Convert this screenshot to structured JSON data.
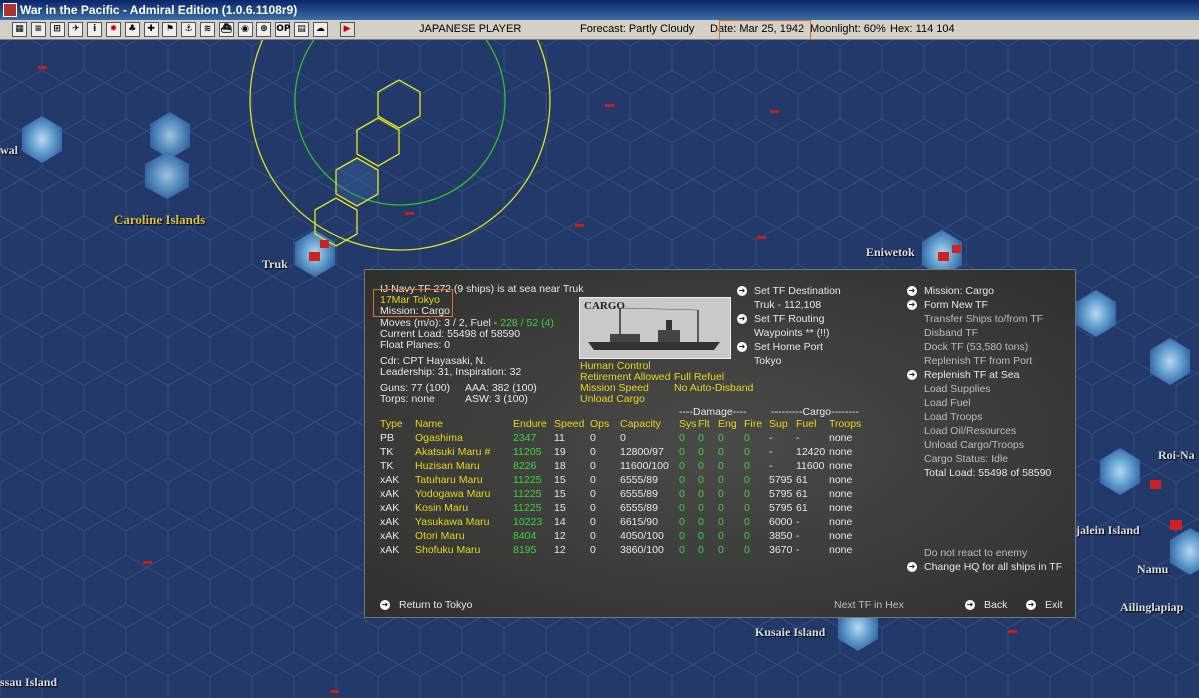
{
  "window": {
    "title": "War in the Pacific - Admiral Edition (1.0.6.1108r9)"
  },
  "toolbar": {
    "player": "JAPANESE PLAYER",
    "forecast": "Forecast: Partly Cloudy",
    "date": "Date: Mar 25, 1942",
    "moonlight": "Moonlight: 60%",
    "hex": "Hex: 114 104",
    "buttons": [
      "map-icon",
      "list-icon",
      "ship-icon",
      "air-icon",
      "info-icon",
      "flag-icon",
      "ground-icon",
      "plane-icon",
      "base-icon",
      "convoy-icon",
      "hq-icon",
      "fleet-icon",
      "globe-icon",
      "report-icon",
      "op-icon",
      "list2-icon",
      "cloud-icon",
      "end-turn-icon"
    ]
  },
  "map_labels": {
    "caroline": "Caroline Islands",
    "truk": "Truk",
    "eniwetok": "Eniwetok",
    "roi": "Roi-Na",
    "jalein": "jalein Island",
    "namu": "Namu",
    "ailing": "Ailinglapiap",
    "kusaie": "Kusaie Island",
    "ssau": "ssau Island",
    "wal": "wal"
  },
  "panel": {
    "header": "IJ Navy TF 272 (9 ships) is at sea near Truk",
    "origin": "17Mar Tokyo",
    "mission": "Mission: Cargo",
    "moves_label": "Moves (m/o): 3 / 2, Fuel - ",
    "moves_fuel": "228 / 52 (4)",
    "current_load": "Current Load: 55498 of 58590",
    "float_planes": "Float Planes: 0",
    "cdr": "Cdr: CPT  Hayasaki, N.",
    "leadership": "Leadership: 31, Inspiration: 32",
    "guns": "Guns: 77 (100)",
    "aaa": "AAA: 382 (100)",
    "torps": "Torps: none",
    "asw": "ASW: 3 (100)",
    "ship_label": "CARGO",
    "options_left": [
      "Human Control",
      "Retirement Allowed",
      "Mission Speed",
      "Unload Cargo"
    ],
    "options_right": [
      "Full Refuel",
      "No Auto-Disband"
    ],
    "center_actions": {
      "set_destination": "Set TF Destination",
      "destination": "Truk - 112,108",
      "set_routing": "Set TF Routing",
      "waypoints": "Waypoints ** (!!)",
      "set_home": "Set Home Port",
      "home": "Tokyo"
    },
    "right_actions": {
      "mission": "Mission: Cargo",
      "form_new": "Form New TF",
      "transfer": "Transfer Ships to/from TF",
      "disband": "Disband TF",
      "dock": "Dock TF (53,580 tons)",
      "replenish_port": "Replenish TF from Port",
      "replenish_sea": "Replenish TF at Sea",
      "load_supplies": "Load Supplies",
      "load_fuel": "Load Fuel",
      "load_troops": "Load Troops",
      "load_oil": "Load Oil/Resources",
      "unload": "Unload Cargo/Troops",
      "cargo_status": "Cargo Status: Idle",
      "total_load": "Total Load: 55498 of 58590",
      "no_react": "Do not react to enemy",
      "change_hq": "Change HQ for all ships in TF"
    },
    "bottom": {
      "return": "Return to Tokyo",
      "next": "Next TF in Hex",
      "back": "Back",
      "exit": "Exit"
    },
    "table": {
      "group_damage": "----Damage----",
      "group_cargo": "---------Cargo--------",
      "headers": [
        "Type",
        "Name",
        "Endure",
        "Speed",
        "Ops",
        "Capacity",
        "Sys",
        "Flt",
        "Eng",
        "Fire",
        "Sup",
        "Fuel",
        "Troops"
      ],
      "rows": [
        [
          "PB",
          "Ogashima",
          "2347",
          "11",
          "0",
          "0",
          "0",
          "0",
          "0",
          "0",
          "-",
          "-",
          "none"
        ],
        [
          "TK",
          "Akatsuki Maru #",
          "11205",
          "19",
          "0",
          "12800/97",
          "0",
          "0",
          "0",
          "0",
          "-",
          "12420",
          "none"
        ],
        [
          "TK",
          "Huzisan Maru",
          "8226",
          "18",
          "0",
          "11600/100",
          "0",
          "0",
          "0",
          "0",
          "-",
          "11600",
          "none"
        ],
        [
          "xAK",
          "Tatuharu Maru",
          "11225",
          "15",
          "0",
          "6555/89",
          "0",
          "0",
          "0",
          "0",
          "5795",
          "61",
          "none"
        ],
        [
          "xAK",
          "Yodogawa Maru",
          "11225",
          "15",
          "0",
          "6555/89",
          "0",
          "0",
          "0",
          "0",
          "5795",
          "61",
          "none"
        ],
        [
          "xAK",
          "Kosin Maru",
          "11225",
          "15",
          "0",
          "6555/89",
          "0",
          "0",
          "0",
          "0",
          "5795",
          "61",
          "none"
        ],
        [
          "xAK",
          "Yasukawa Maru",
          "10223",
          "14",
          "0",
          "6615/90",
          "0",
          "0",
          "0",
          "0",
          "6000",
          "-",
          "none"
        ],
        [
          "xAK",
          "Otori Maru",
          "8404",
          "12",
          "0",
          "4050/100",
          "0",
          "0",
          "0",
          "0",
          "3850",
          "-",
          "none"
        ],
        [
          "xAK",
          "Shofuku Maru",
          "8195",
          "12",
          "0",
          "3860/100",
          "0",
          "0",
          "0",
          "0",
          "3670",
          "-",
          "none"
        ]
      ]
    }
  }
}
